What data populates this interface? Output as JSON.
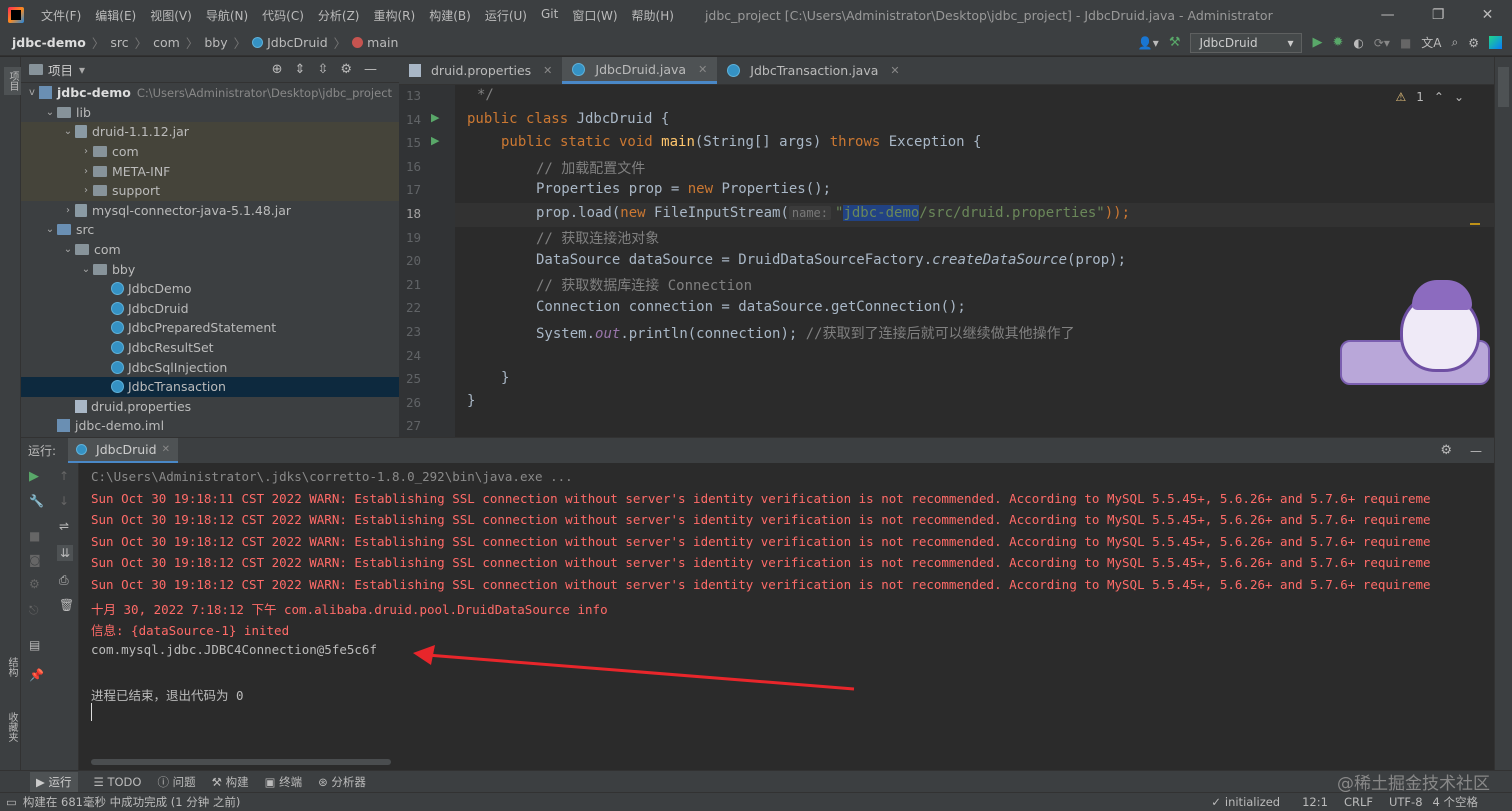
{
  "window": {
    "title": "jdbc_project [C:\\Users\\Administrator\\Desktop\\jdbc_project] - JdbcDruid.java - Administrator",
    "menu": [
      "文件(F)",
      "编辑(E)",
      "视图(V)",
      "导航(N)",
      "代码(C)",
      "分析(Z)",
      "重构(R)",
      "构建(B)",
      "运行(U)",
      "Git",
      "窗口(W)",
      "帮助(H)"
    ]
  },
  "breadcrumb": {
    "items": [
      "jdbc-demo",
      "src",
      "com",
      "bby",
      "JdbcDruid",
      "main"
    ],
    "run_config": "JdbcDruid"
  },
  "sidebar_left": {
    "project_label": "项目",
    "structure_label": "结构",
    "favorites_label": "收藏夹"
  },
  "project_panel": {
    "title": "项目",
    "root_name": "jdbc-demo",
    "root_path": "C:\\Users\\Administrator\\Desktop\\jdbc_project",
    "tree": [
      {
        "label": "lib",
        "depth": 1,
        "type": "folder",
        "arrow": "v"
      },
      {
        "label": "druid-1.1.12.jar",
        "depth": 2,
        "type": "jar",
        "arrow": "v"
      },
      {
        "label": "com",
        "depth": 3,
        "type": "folder",
        "arrow": ">"
      },
      {
        "label": "META-INF",
        "depth": 3,
        "type": "folder",
        "arrow": ">"
      },
      {
        "label": "support",
        "depth": 3,
        "type": "folder",
        "arrow": ">"
      },
      {
        "label": "mysql-connector-java-5.1.48.jar",
        "depth": 2,
        "type": "jar",
        "arrow": ">"
      },
      {
        "label": "src",
        "depth": 1,
        "type": "src",
        "arrow": "v"
      },
      {
        "label": "com",
        "depth": 2,
        "type": "folder",
        "arrow": "v"
      },
      {
        "label": "bby",
        "depth": 3,
        "type": "folder",
        "arrow": "v"
      },
      {
        "label": "JdbcDemo",
        "depth": 4,
        "type": "class",
        "arrow": ""
      },
      {
        "label": "JdbcDruid",
        "depth": 4,
        "type": "class",
        "arrow": ""
      },
      {
        "label": "JdbcPreparedStatement",
        "depth": 4,
        "type": "class",
        "arrow": ""
      },
      {
        "label": "JdbcResultSet",
        "depth": 4,
        "type": "class",
        "arrow": ""
      },
      {
        "label": "JdbcSqlInjection",
        "depth": 4,
        "type": "class",
        "arrow": ""
      },
      {
        "label": "JdbcTransaction",
        "depth": 4,
        "type": "class",
        "arrow": ""
      },
      {
        "label": "druid.properties",
        "depth": 2,
        "type": "prop",
        "arrow": ""
      },
      {
        "label": "jdbc-demo.iml",
        "depth": 1,
        "type": "module",
        "arrow": ""
      }
    ],
    "selected_index": 14
  },
  "editor": {
    "tabs": [
      {
        "label": "druid.properties",
        "active": false
      },
      {
        "label": "JdbcDruid.java",
        "active": true
      },
      {
        "label": "JdbcTransaction.java",
        "active": false
      }
    ],
    "warnings": "1",
    "line_numbers": [
      "13",
      "14",
      "15",
      "16",
      "17",
      "18",
      "19",
      "20",
      "21",
      "22",
      "23",
      "24",
      "25",
      "26",
      "27"
    ],
    "code": {
      "l13": "*/",
      "l14_kw": "public class ",
      "l14_name": "JdbcDruid {",
      "l15_kw1": "public static void ",
      "l15_fn": "main",
      "l15_args": "(String[] args) ",
      "l15_kw2": "throws ",
      "l15_rest": "Exception {",
      "l16": "// 加载配置文件",
      "l17_a": "Properties prop = ",
      "l17_kw": "new ",
      "l17_b": "Properties();",
      "l18_a": "prop.load(",
      "l18_kw": "new ",
      "l18_b": "FileInputStream(",
      "l18_hint": "name:",
      "l18_str_q": "\"",
      "l18_str_sel": "jdbc-demo",
      "l18_str_rest": "/src/druid.properties\"",
      "l18_end": "));",
      "l19": "// 获取连接池对象",
      "l20_a": "DataSource dataSource = DruidDataSourceFactory.",
      "l20_it": "createDataSource",
      "l20_b": "(prop);",
      "l21": "// 获取数据库连接 Connection",
      "l22": "Connection connection = dataSource.getConnection();",
      "l23_a": "System.",
      "l23_out": "out",
      "l23_b": ".println(connection); ",
      "l23_cm": "//获取到了连接后就可以继续做其他操作了",
      "l25": "}",
      "l26": "}"
    }
  },
  "run_panel": {
    "label": "运行:",
    "tab": "JdbcDruid",
    "lines": [
      {
        "text": "C:\\Users\\Administrator\\.jdks\\corretto-1.8.0_292\\bin\\java.exe ...",
        "style": "gray"
      },
      {
        "text": "Sun Oct 30 19:18:11 CST 2022 WARN: Establishing SSL connection without server's identity verification is not recommended. According to MySQL 5.5.45+, 5.6.26+ and 5.7.6+ requireme",
        "style": "err"
      },
      {
        "text": "Sun Oct 30 19:18:12 CST 2022 WARN: Establishing SSL connection without server's identity verification is not recommended. According to MySQL 5.5.45+, 5.6.26+ and 5.7.6+ requireme",
        "style": "err"
      },
      {
        "text": "Sun Oct 30 19:18:12 CST 2022 WARN: Establishing SSL connection without server's identity verification is not recommended. According to MySQL 5.5.45+, 5.6.26+ and 5.7.6+ requireme",
        "style": "err"
      },
      {
        "text": "Sun Oct 30 19:18:12 CST 2022 WARN: Establishing SSL connection without server's identity verification is not recommended. According to MySQL 5.5.45+, 5.6.26+ and 5.7.6+ requireme",
        "style": "err"
      },
      {
        "text": "Sun Oct 30 19:18:12 CST 2022 WARN: Establishing SSL connection without server's identity verification is not recommended. According to MySQL 5.5.45+, 5.6.26+ and 5.7.6+ requireme",
        "style": "err"
      },
      {
        "text": "十月 30, 2022 7:18:12 下午 com.alibaba.druid.pool.DruidDataSource info",
        "style": "err"
      },
      {
        "text": "信息: {dataSource-1} inited",
        "style": "err"
      },
      {
        "text": "com.mysql.jdbc.JDBC4Connection@5fe5c6f",
        "style": "norm"
      },
      {
        "text": "",
        "style": "norm"
      },
      {
        "text": "进程已结束，退出代码为 0",
        "style": "norm"
      }
    ]
  },
  "bottom_tools": [
    "运行",
    "TODO",
    "问题",
    "构建",
    "终端",
    "分析器"
  ],
  "status": {
    "message": "构建在 681毫秒 中成功完成 (1 分钟 之前)",
    "initialized": "initialized",
    "position": "12:1",
    "line_sep": "CRLF",
    "encoding": "UTF-8",
    "indent": "4 个空格"
  },
  "watermark": "@稀土掘金技术社区",
  "colors": {
    "accent": "#4a88c7",
    "error": "#ff6b68",
    "arrow": "#e8262b"
  }
}
